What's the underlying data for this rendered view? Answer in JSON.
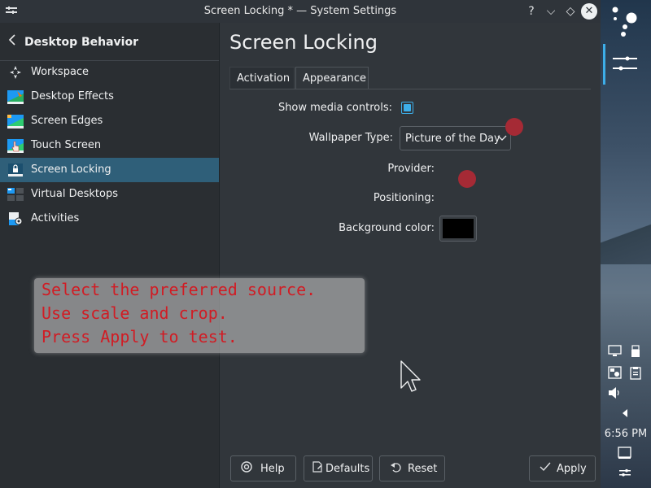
{
  "window": {
    "title": "Screen Locking * — System Settings",
    "buttons": {
      "help": "?",
      "minimize": "⌵",
      "maximize": "◇",
      "close": "✕"
    }
  },
  "sidebar": {
    "back_label": "Desktop Behavior",
    "items": [
      {
        "label": "Workspace",
        "icon": "workspace-icon"
      },
      {
        "label": "Desktop Effects",
        "icon": "desktop-effects-icon"
      },
      {
        "label": "Screen Edges",
        "icon": "screen-edges-icon"
      },
      {
        "label": "Touch Screen",
        "icon": "touch-screen-icon"
      },
      {
        "label": "Screen Locking",
        "icon": "screen-locking-icon",
        "active": true
      },
      {
        "label": "Virtual Desktops",
        "icon": "virtual-desktops-icon"
      },
      {
        "label": "Activities",
        "icon": "activities-icon"
      }
    ]
  },
  "main": {
    "page_title": "Screen Locking",
    "tabs": [
      {
        "label": "Activation"
      },
      {
        "label": "Appearance",
        "active": true
      }
    ],
    "form": {
      "show_media_controls_label": "Show media controls:",
      "show_media_controls_checked": true,
      "wallpaper_type_label": "Wallpaper Type:",
      "wallpaper_type_value": "Picture of the Day",
      "provider_label": "Provider:",
      "positioning_label": "Positioning:",
      "background_color_label": "Background color:",
      "background_color_value": "#000000"
    }
  },
  "overlay": {
    "lines": [
      "Select the preferred source.",
      "Use scale and crop.",
      "Press Apply to test."
    ],
    "color": "#d11c24"
  },
  "footer": {
    "help": "Help",
    "defaults": "Defaults",
    "reset": "Reset",
    "apply": "Apply"
  },
  "panel": {
    "clock": "6:56 PM"
  },
  "colors": {
    "accent": "#3daee9",
    "selection": "#2f5f79",
    "marker": "#a52a35"
  }
}
